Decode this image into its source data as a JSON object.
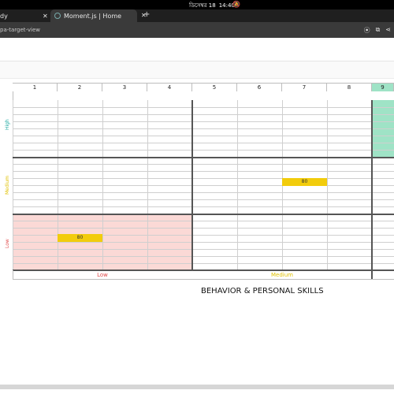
{
  "os": {
    "date": "ডিসেম্বর 18",
    "time": "14:40"
  },
  "tabs": [
    {
      "label": "dy"
    },
    {
      "label": "Moment.js | Home"
    }
  ],
  "address": {
    "url": "pa-target-view"
  },
  "grid": {
    "columns": [
      "1",
      "2",
      "3",
      "4",
      "5",
      "6",
      "7",
      "8",
      "9"
    ],
    "rows": [
      {
        "label": "High",
        "color": "#19a7a0"
      },
      {
        "label": "Medium",
        "color": "#e0c100"
      },
      {
        "label": "Low",
        "color": "#e04a4a"
      }
    ],
    "badges": [
      {
        "value": "80",
        "row": "Medium",
        "col": 7
      },
      {
        "value": "80",
        "row": "Low",
        "col": 2
      }
    ],
    "bottom_labels": [
      {
        "label": "Low",
        "color": "#e04a4a"
      },
      {
        "label": "Medium",
        "color": "#e0c100"
      }
    ],
    "highlight_colors": {
      "top_right": "#9fe3c6",
      "bottom_left": "#fbd9d6"
    }
  },
  "axis_title": "BEHAVIOR & PERSONAL SKILLS"
}
